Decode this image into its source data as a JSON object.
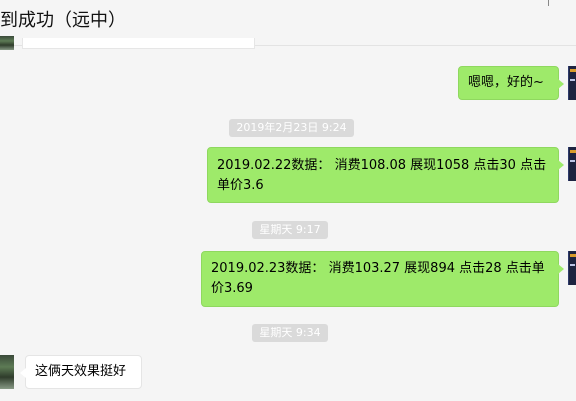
{
  "header": {
    "title": "到成功（远中）"
  },
  "messages": [
    {
      "side": "out",
      "text": "嗯嗯，好的~"
    },
    {
      "time": "2019年2月23日 9:24"
    },
    {
      "side": "out",
      "text": "2019.02.22数据： 消费108.08 展现1058 点击30 点击单价3.6"
    },
    {
      "time": "星期天 9:17"
    },
    {
      "side": "out",
      "text": "2019.02.23数据： 消费103.27 展现894 点击28 点击单价3.69"
    },
    {
      "time": "星期天 9:34"
    },
    {
      "side": "in",
      "text": "这俩天效果挺好"
    }
  ]
}
